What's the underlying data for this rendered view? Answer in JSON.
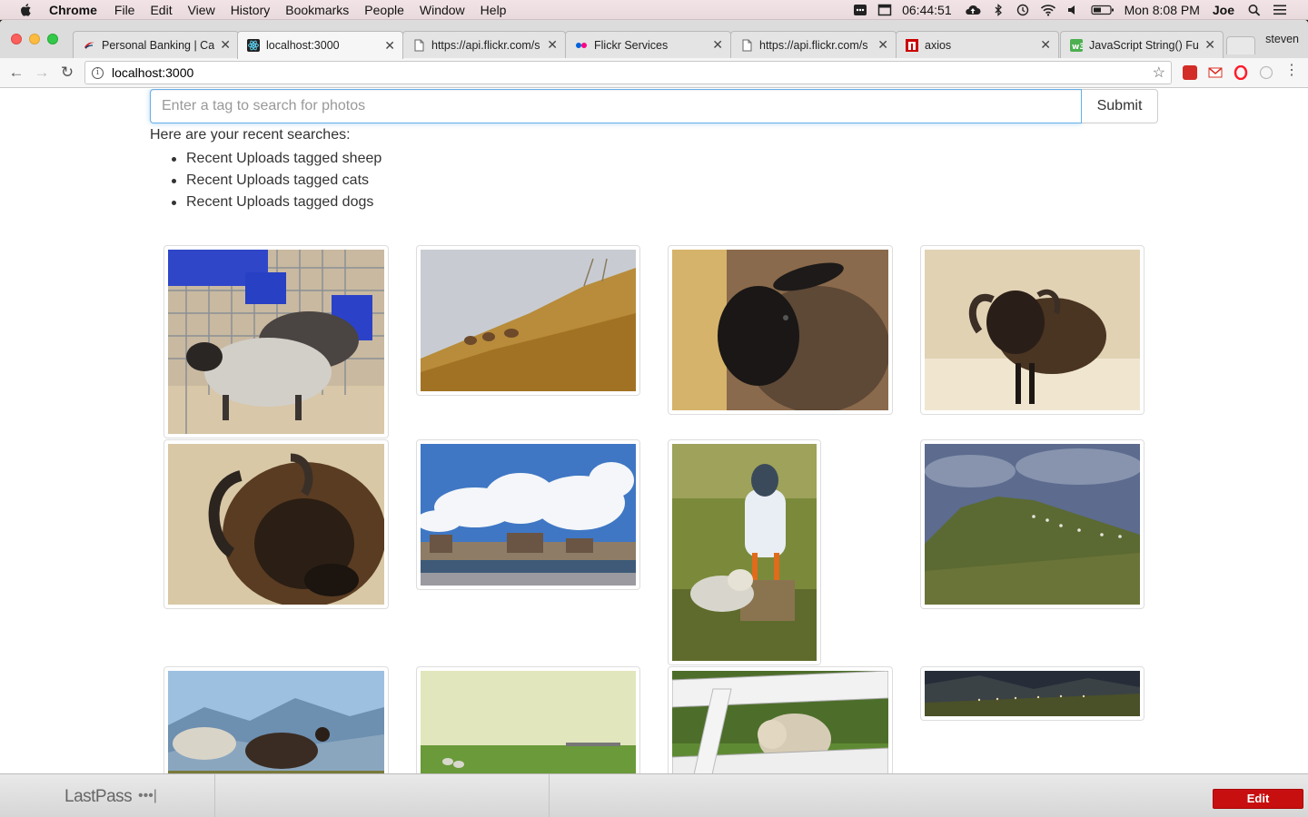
{
  "menubar": {
    "app": "Chrome",
    "items": [
      "File",
      "Edit",
      "View",
      "History",
      "Bookmarks",
      "People",
      "Window",
      "Help"
    ],
    "clock": "06:44:51",
    "datetime": "Mon 8:08 PM",
    "user": "Joe"
  },
  "tabs": [
    {
      "label": "Personal Banking | Ca",
      "icon": "capital-one-icon",
      "active": false
    },
    {
      "label": "localhost:3000",
      "icon": "react-icon",
      "active": true
    },
    {
      "label": "https://api.flickr.com/s",
      "icon": "page-icon",
      "active": false
    },
    {
      "label": "Flickr Services",
      "icon": "flickr-icon",
      "active": false
    },
    {
      "label": "https://api.flickr.com/s",
      "icon": "page-icon",
      "active": false
    },
    {
      "label": "axios",
      "icon": "npm-icon",
      "active": false
    },
    {
      "label": "JavaScript String() Fu",
      "icon": "w3schools-icon",
      "active": false
    }
  ],
  "profile": "steven",
  "address": "localhost:3000",
  "search": {
    "placeholder": "Enter a tag to search for photos",
    "value": "",
    "submit_label": "Submit"
  },
  "recent": {
    "heading": "Here are your recent searches:",
    "items": [
      "Recent Uploads tagged sheep",
      "Recent Uploads tagged cats",
      "Recent Uploads tagged dogs"
    ]
  },
  "photos": [
    "sheep-in-pen-photo",
    "deer-on-hillside-photo",
    "black-sheep-face-photo",
    "horned-sheep-photo",
    "ram-closeup-photo",
    "city-harbor-clouds-photo",
    "penguin-figure-lamb-photo",
    "grassy-hill-sheep-photo",
    "mountain-sheep-goat-photo",
    "green-field-sheep-photo",
    "sheep-behind-fence-photo",
    "dusk-valley-sheep-photo"
  ],
  "lastpass": {
    "logo": "LastPass",
    "edit_label": "Edit"
  }
}
